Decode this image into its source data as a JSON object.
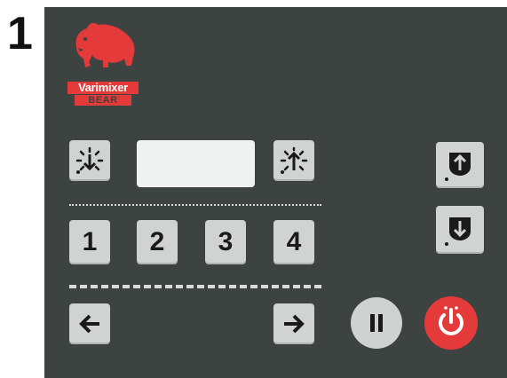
{
  "figure": {
    "step_number": "1"
  },
  "brand": {
    "name": "Varimixer",
    "sub": "BEAR"
  },
  "speed": {
    "down_icon": "speed-down-icon",
    "up_icon": "speed-up-icon",
    "display_value": ""
  },
  "bowl": {
    "up_icon": "bowl-up-icon",
    "down_icon": "bowl-down-icon"
  },
  "timers": {
    "buttons": [
      "1",
      "2",
      "3",
      "4"
    ]
  },
  "nav": {
    "left_icon": "arrow-left-icon",
    "right_icon": "arrow-right-icon"
  },
  "controls": {
    "pause_icon": "pause-icon",
    "power_icon": "power-icon"
  },
  "colors": {
    "panel": "#3d4341",
    "button": "#d0d3d2",
    "accent_red": "#e43a3a",
    "pause": "#cfd2d1"
  }
}
